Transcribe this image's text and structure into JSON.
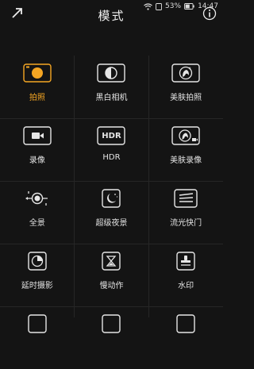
{
  "status": {
    "battery": "53%",
    "time": "14:47"
  },
  "header": {
    "title": "模式"
  },
  "modes": [
    {
      "label": "拍照",
      "icon": "camera-selected-icon",
      "selected": true
    },
    {
      "label": "黑白相机",
      "icon": "black-white-icon"
    },
    {
      "label": "美肤拍照",
      "icon": "beauty-photo-icon"
    },
    {
      "label": "录像",
      "icon": "video-icon"
    },
    {
      "label": "HDR",
      "icon": "hdr-icon",
      "icon_text": "HDR"
    },
    {
      "label": "美肤录像",
      "icon": "beauty-video-icon"
    },
    {
      "label": "全景",
      "icon": "panorama-icon"
    },
    {
      "label": "超级夜景",
      "icon": "night-icon"
    },
    {
      "label": "流光快门",
      "icon": "light-painting-icon"
    },
    {
      "label": "延时摄影",
      "icon": "timelapse-icon"
    },
    {
      "label": "慢动作",
      "icon": "slow-motion-icon"
    },
    {
      "label": "水印",
      "icon": "watermark-icon"
    }
  ],
  "colors": {
    "accent": "#f5a623",
    "background": "#141414",
    "icon": "#e6e6e6"
  }
}
